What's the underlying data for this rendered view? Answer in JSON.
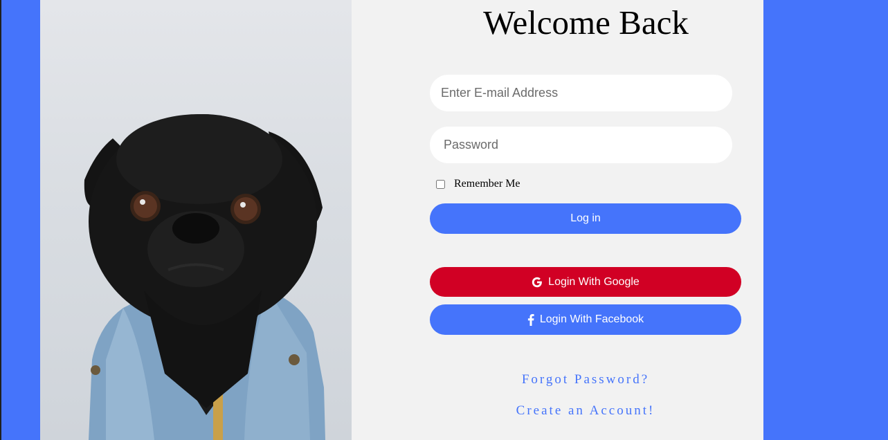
{
  "page": {
    "title": "Welcome Back"
  },
  "form": {
    "email_placeholder": "Enter E-mail Address",
    "password_placeholder": "Password",
    "remember_label": "Remember Me",
    "remember_checked": false,
    "login_label": "Log in",
    "google_label": "Login With Google",
    "facebook_label": "Login With Facebook",
    "forgot_label": "Forgot Password?",
    "create_label": "Create an Account!"
  },
  "icons": {
    "google": "google-icon",
    "facebook": "facebook-icon"
  },
  "colors": {
    "background": "#4574fb",
    "card": "#f2f2f2",
    "primary": "#4574fb",
    "google": "#d10024",
    "link": "#4574fb"
  }
}
